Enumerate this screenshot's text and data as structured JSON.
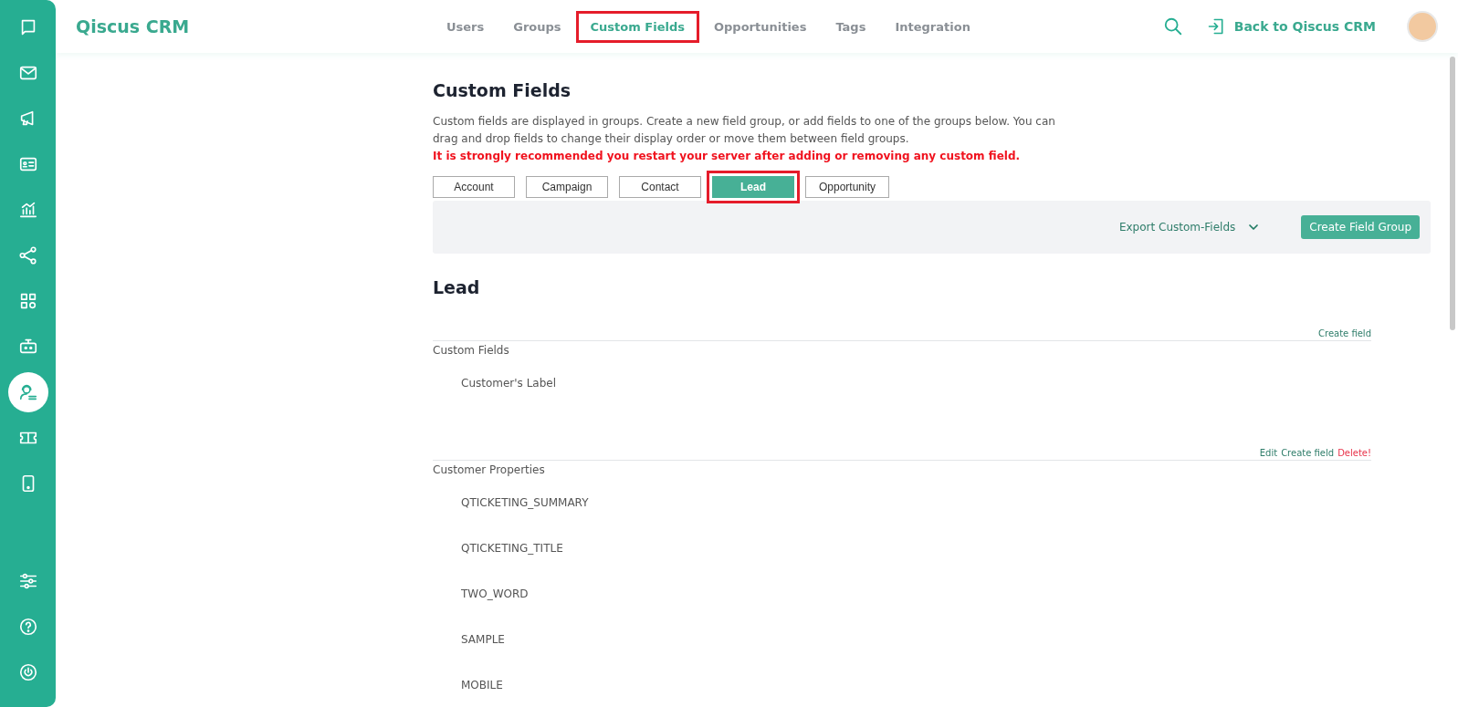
{
  "sidebar": {
    "items": [
      {
        "selected": false
      },
      {
        "selected": false
      },
      {
        "selected": false
      },
      {
        "selected": false
      },
      {
        "selected": false
      },
      {
        "selected": false
      },
      {
        "selected": false
      },
      {
        "selected": false
      },
      {
        "selected": true
      },
      {
        "selected": false
      },
      {
        "selected": false
      }
    ]
  },
  "header": {
    "brand": "Qiscus CRM",
    "nav": [
      {
        "label": "Users",
        "selected": false,
        "highlighted": false
      },
      {
        "label": "Groups",
        "selected": false,
        "highlighted": false
      },
      {
        "label": "Custom Fields",
        "selected": true,
        "highlighted": true
      },
      {
        "label": "Opportunities",
        "selected": false,
        "highlighted": false
      },
      {
        "label": "Tags",
        "selected": false,
        "highlighted": false
      },
      {
        "label": "Integration",
        "selected": false,
        "highlighted": false
      }
    ],
    "back_link": "Back to Qiscus CRM"
  },
  "page": {
    "title": "Custom Fields",
    "description": "Custom fields are displayed in groups. Create a new field group, or add fields to one of the groups below. You can drag and drop fields to change their display order or move them between field groups.",
    "warning": "It is strongly recommended you restart your server after adding or removing any custom field.",
    "tabs": [
      {
        "label": "Account",
        "selected": false,
        "highlighted": false
      },
      {
        "label": "Campaign",
        "selected": false,
        "highlighted": false
      },
      {
        "label": "Contact",
        "selected": false,
        "highlighted": false
      },
      {
        "label": "Lead",
        "selected": true,
        "highlighted": true
      },
      {
        "label": "Opportunity",
        "selected": false,
        "highlighted": false
      }
    ],
    "export_label": "Export Custom-Fields",
    "create_group_button": "Create Field Group",
    "section_title": "Lead",
    "groups": [
      {
        "name": "Custom Fields",
        "actions": [
          {
            "label": "Create field",
            "kind": "create"
          }
        ],
        "fields": [
          "Customer's Label"
        ]
      },
      {
        "name": "Customer Properties",
        "actions": [
          {
            "label": "Edit",
            "kind": "edit"
          },
          {
            "label": "Create field",
            "kind": "create"
          },
          {
            "label": "Delete!",
            "kind": "delete"
          }
        ],
        "fields": [
          "QTICKETING_SUMMARY",
          "QTICKETING_TITLE",
          "TWO_WORD",
          "SAMPLE",
          "MOBILE"
        ]
      }
    ]
  }
}
